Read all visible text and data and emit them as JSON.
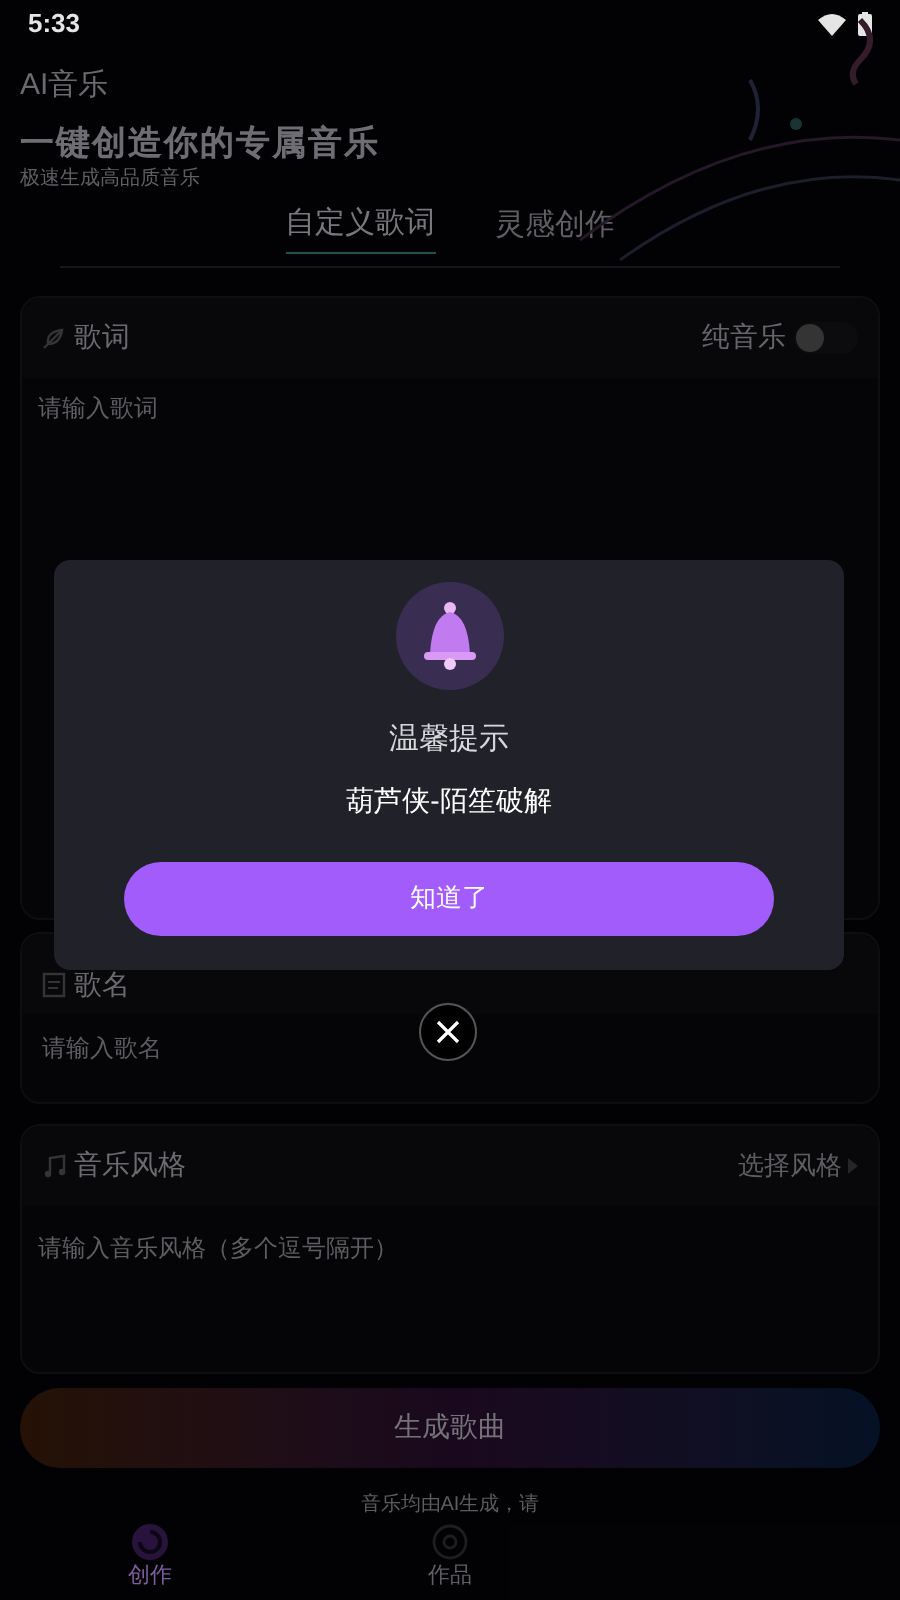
{
  "status_bar": {
    "time": "5:33"
  },
  "header": {
    "app_name": "AI音乐",
    "title": "一键创造你的专属音乐",
    "subtitle": "极速生成高品质音乐"
  },
  "tabs": [
    {
      "label": "自定义歌词",
      "selected": true
    },
    {
      "label": "灵感创作",
      "selected": false
    }
  ],
  "lyrics_card": {
    "title": "歌词",
    "toggle_label": "纯音乐",
    "toggle_on": false,
    "placeholder": "请输入歌词"
  },
  "song_name_card": {
    "title": "歌名",
    "placeholder": "请输入歌名"
  },
  "style_card": {
    "title": "音乐风格",
    "action": "选择风格",
    "placeholder": "请输入音乐风格（多个逗号隔开）"
  },
  "generate_button": "生成歌曲",
  "disclaimer": "音乐均由AI生成，请",
  "bottom_nav": [
    {
      "label": "创作",
      "selected": true
    },
    {
      "label": "作品",
      "selected": false
    }
  ],
  "dialog": {
    "title": "温馨提示",
    "message": "葫芦侠-陌笙破解",
    "button": "知道了"
  }
}
